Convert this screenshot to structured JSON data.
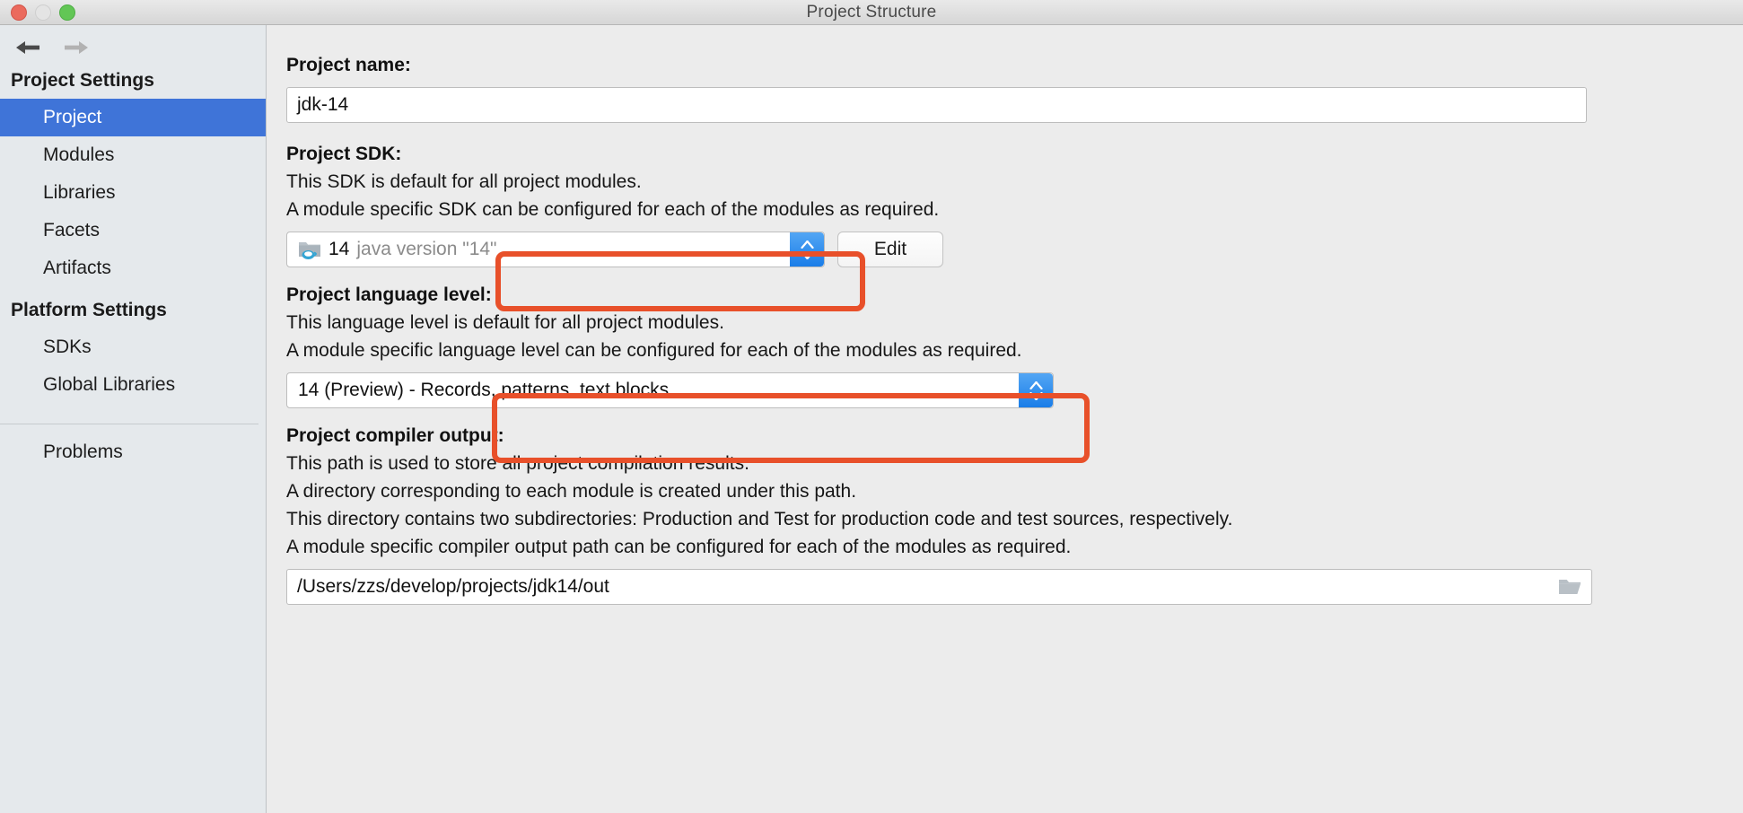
{
  "window": {
    "title": "Project Structure",
    "traffic_lights": [
      "close-button",
      "minimize-button",
      "maximize-button"
    ]
  },
  "nav": {
    "back_label": "back-arrow",
    "forward_label": "forward-arrow"
  },
  "sidebar": {
    "groups": [
      {
        "title": "Project Settings",
        "items": [
          {
            "label": "Project",
            "selected": true
          },
          {
            "label": "Modules",
            "selected": false
          },
          {
            "label": "Libraries",
            "selected": false
          },
          {
            "label": "Facets",
            "selected": false
          },
          {
            "label": "Artifacts",
            "selected": false
          }
        ]
      },
      {
        "title": "Platform Settings",
        "items": [
          {
            "label": "SDKs",
            "selected": false
          },
          {
            "label": "Global Libraries",
            "selected": false
          }
        ]
      }
    ],
    "footer_item": "Problems"
  },
  "main": {
    "project_name": {
      "label": "Project name:",
      "value": "jdk-14"
    },
    "project_sdk": {
      "label": "Project SDK:",
      "description_line1": "This SDK is default for all project modules.",
      "description_line2": "A module specific SDK can be configured for each of the modules as required.",
      "selected_version": "14",
      "selected_detail": "java version \"14\"",
      "icon": "jdk-folder-icon",
      "edit_button": "Edit"
    },
    "language_level": {
      "label": "Project language level:",
      "description_line1": "This language level is default for all project modules.",
      "description_line2": "A module specific language level can be configured for each of the modules as required.",
      "selected": "14 (Preview) - Records, patterns, text blocks"
    },
    "compiler_output": {
      "label": "Project compiler output:",
      "description_line1": "This path is used to store all project compilation results.",
      "description_line2": "A directory corresponding to each module is created under this path.",
      "description_line3": "This directory contains two subdirectories: Production and Test for production code and test sources, respectively.",
      "description_line4": "A module specific compiler output path can be configured for each of the modules as required.",
      "path_value": "/Users/zzs/develop/projects/jdk14/out",
      "browse_icon": "folder-icon"
    }
  },
  "annotations": {
    "color": "#e8502a",
    "boxes": [
      {
        "name": "sdk-combobox-highlight"
      },
      {
        "name": "language-level-combobox-highlight"
      }
    ]
  },
  "colors": {
    "accent_selection": "#3f74d8",
    "stepper_blue": "#1a7de8",
    "annotation_red": "#e8502a",
    "sidebar_bg": "#e5e9ec",
    "content_bg": "#ececec"
  }
}
